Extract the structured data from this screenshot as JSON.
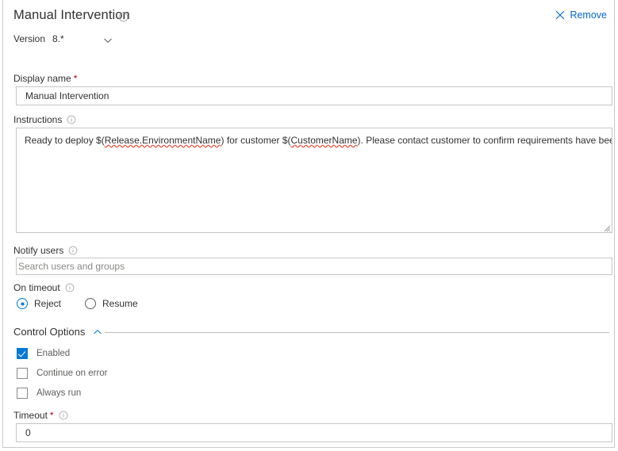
{
  "header": {
    "title": "Manual Intervention",
    "info_icon": "info-icon",
    "remove_label": "Remove",
    "remove_icon": "close-x-icon"
  },
  "version": {
    "label": "Version",
    "value": "8.*",
    "chevron_icon": "chevron-down-icon"
  },
  "fields": {
    "display_name": {
      "label": "Display name",
      "required": true,
      "value": "Manual Intervention"
    },
    "instructions": {
      "label": "Instructions",
      "info_icon": "info-icon",
      "text_parts": [
        {
          "text": "Ready to deploy $(",
          "misspelled": false
        },
        {
          "text": "Release.EnvironmentName",
          "misspelled": true
        },
        {
          "text": ") for customer $(",
          "misspelled": false
        },
        {
          "text": "CustomerName",
          "misspelled": true
        },
        {
          "text": "). Please contact customer to confirm requirements have been met.",
          "misspelled": false
        }
      ],
      "full_text": "Ready to deploy $(Release.EnvironmentName) for customer $(CustomerName). Please contact customer to confirm requirements have been met.",
      "resize_grip": "resize-handle-icon"
    },
    "notify_users": {
      "label": "Notify users",
      "info_icon": "info-icon",
      "value": "",
      "placeholder": "Search users and groups"
    },
    "on_timeout": {
      "label": "On timeout",
      "info_icon": "info-icon",
      "options": [
        {
          "label": "Reject",
          "selected": true
        },
        {
          "label": "Resume",
          "selected": false
        }
      ]
    },
    "timeout": {
      "label": "Timeout",
      "required": true,
      "info_icon": "info-icon",
      "value": "0"
    }
  },
  "control_options": {
    "title": "Control Options",
    "chevron_icon": "chevron-up-icon",
    "checkboxes": [
      {
        "label": "Enabled",
        "checked": true
      },
      {
        "label": "Continue on error",
        "checked": false
      },
      {
        "label": "Always run",
        "checked": false
      }
    ]
  },
  "colors": {
    "accent": "#0078d4",
    "link": "#0066cc",
    "text": "#323130",
    "muted": "#605e5c",
    "border": "#c8c6c4",
    "required": "#a80000",
    "spellcheck": "#e74c3c"
  }
}
